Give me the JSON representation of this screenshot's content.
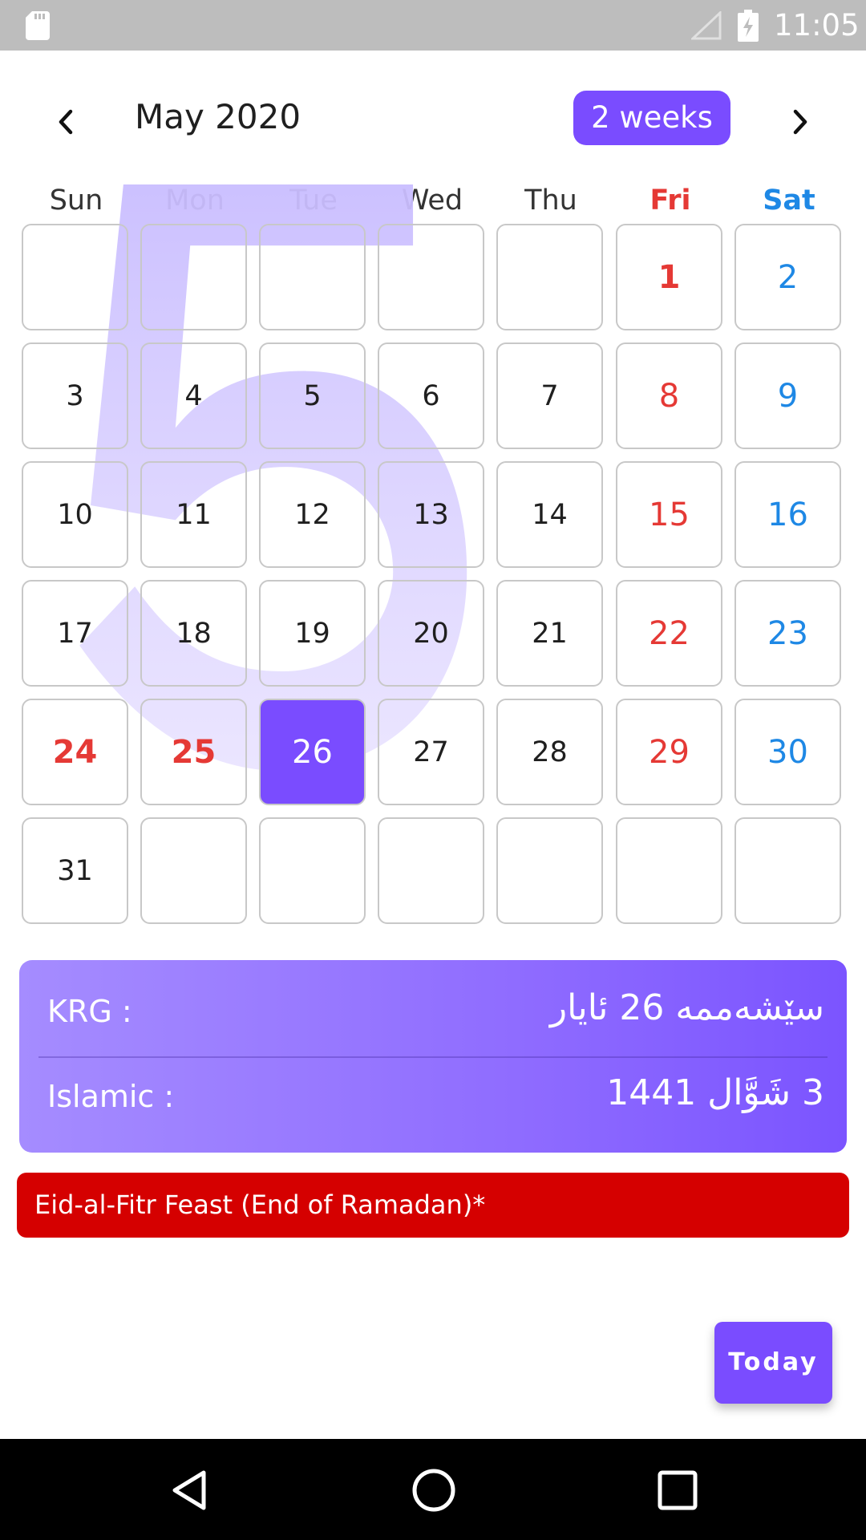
{
  "status_bar": {
    "time": "11:05"
  },
  "header": {
    "title": "May 2020",
    "view_toggle": "2 weeks",
    "prev_icon": "chevron-left-icon",
    "next_icon": "chevron-right-icon"
  },
  "weekdays": [
    "Sun",
    "Mon",
    "Tue",
    "Wed",
    "Thu",
    "Fri",
    "Sat"
  ],
  "calendar": {
    "watermark_digit": "5",
    "weeks": [
      [
        "",
        "",
        "",
        "",
        "",
        "1",
        "2"
      ],
      [
        "3",
        "4",
        "5",
        "6",
        "7",
        "8",
        "9"
      ],
      [
        "10",
        "11",
        "12",
        "13",
        "14",
        "15",
        "16"
      ],
      [
        "17",
        "18",
        "19",
        "20",
        "21",
        "22",
        "23"
      ],
      [
        "24",
        "25",
        "26",
        "27",
        "28",
        "29",
        "30"
      ],
      [
        "31",
        "",
        "",
        "",
        "",
        "",
        ""
      ]
    ],
    "selected_day": "26",
    "holiday_days": [
      "1",
      "24",
      "25"
    ]
  },
  "info_card": {
    "krg_label": "KRG :",
    "krg_value": "سێشەممە 26 ئایار",
    "islamic_label": "Islamic :",
    "islamic_value": "3 شَوَّال 1441"
  },
  "event": {
    "text": "Eid-al-Fitr Feast (End of Ramadan)*"
  },
  "today_button": {
    "label": "Today"
  },
  "colors": {
    "accent": "#7a4cff",
    "friday": "#e53935",
    "saturday": "#1e88e5",
    "event_bg": "#d50000"
  }
}
